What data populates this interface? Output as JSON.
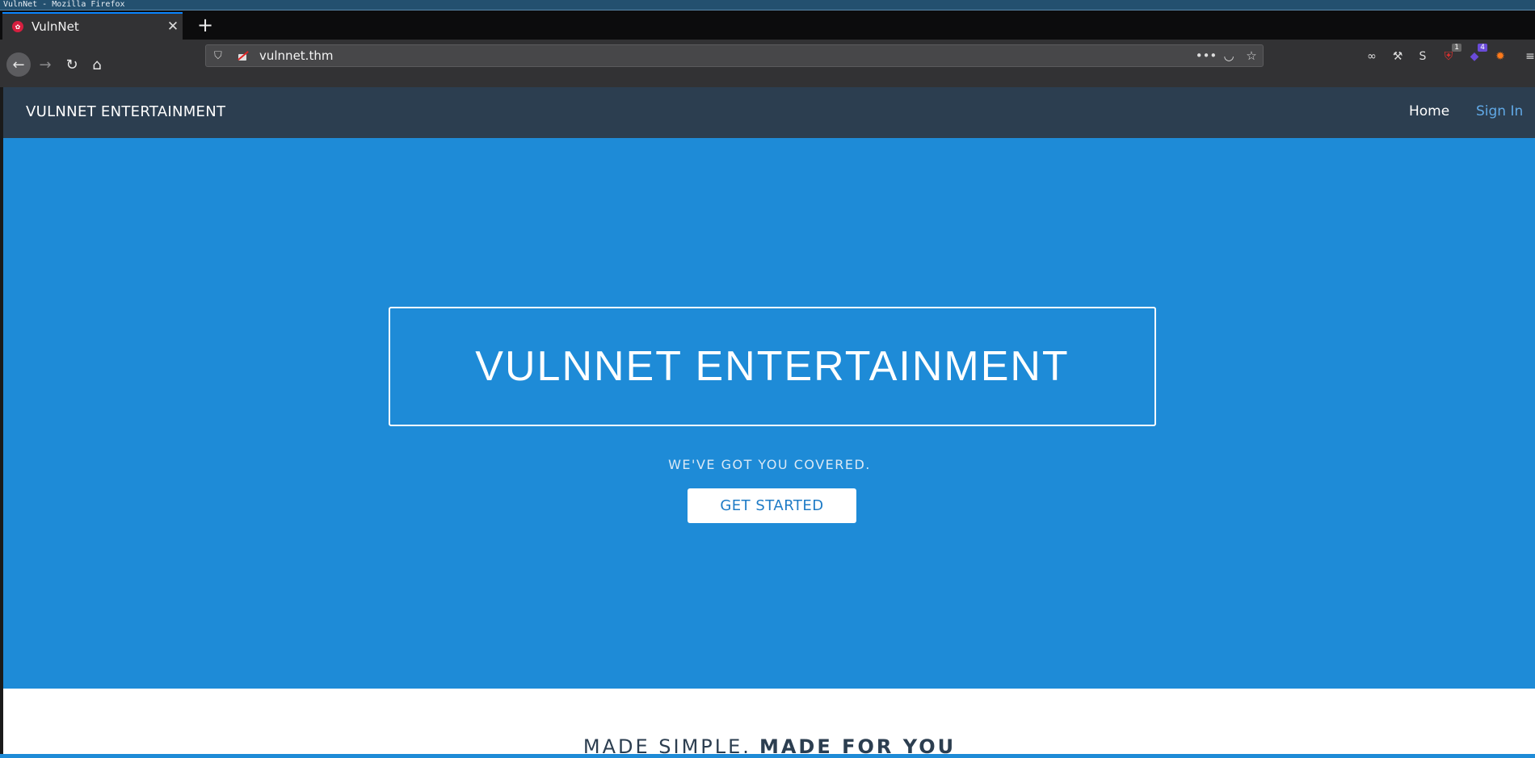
{
  "window": {
    "title": "VulnNet - Mozilla Firefox"
  },
  "browser": {
    "tab": {
      "title": "VulnNet"
    },
    "url": "vulnnet.thm",
    "badges": {
      "ublock": "1",
      "ext2": "4"
    }
  },
  "site": {
    "brand": "VULNNET ENTERTAINMENT",
    "nav": {
      "home": "Home",
      "signin": "Sign In"
    },
    "hero": {
      "title": "VULNNET ENTERTAINMENT",
      "subtitle": "WE'VE GOT YOU COVERED.",
      "cta": "GET STARTED"
    },
    "section": {
      "light": "MADE SIMPLE.",
      "bold": "MADE FOR YOU"
    }
  },
  "colors": {
    "hero_bg": "#1e8bd7",
    "nav_bg": "#2c3e50",
    "signin_link": "#61a9e6"
  }
}
